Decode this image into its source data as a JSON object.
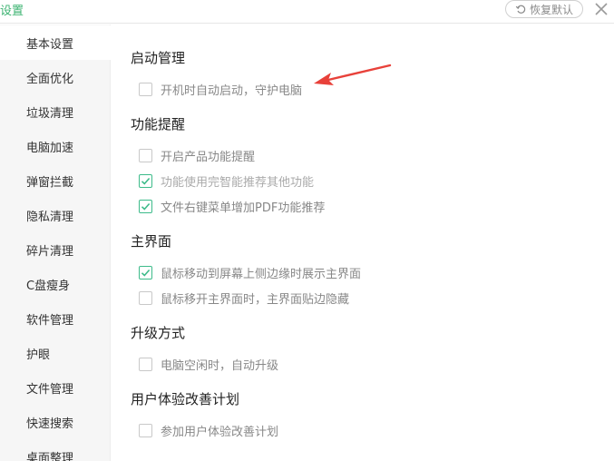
{
  "window": {
    "title": "设置",
    "restore_label": "恢复默认",
    "close_icon": "close-icon"
  },
  "colors": {
    "accent": "#3cb371",
    "check": "#3dbb8a",
    "annotation_arrow": "#e8413a"
  },
  "sidebar": {
    "items": [
      {
        "label": "基本设置",
        "active": true
      },
      {
        "label": "全面优化"
      },
      {
        "label": "垃圾清理"
      },
      {
        "label": "电脑加速"
      },
      {
        "label": "弹窗拦截"
      },
      {
        "label": "隐私清理"
      },
      {
        "label": "碎片清理"
      },
      {
        "label": "C盘瘦身"
      },
      {
        "label": "软件管理"
      },
      {
        "label": "护眼"
      },
      {
        "label": "文件管理"
      },
      {
        "label": "快速搜索"
      },
      {
        "label": "桌面整理"
      }
    ]
  },
  "sections": [
    {
      "title": "启动管理",
      "options": [
        {
          "label": "开机时自动启动，守护电脑",
          "checked": false
        }
      ]
    },
    {
      "title": "功能提醒",
      "options": [
        {
          "label": "开启产品功能提醒",
          "checked": false
        },
        {
          "label": "功能使用完智能推荐其他功能",
          "checked": true,
          "dim": true
        },
        {
          "label": "文件右键菜单增加PDF功能推荐",
          "checked": true
        }
      ]
    },
    {
      "title": "主界面",
      "options": [
        {
          "label": "鼠标移动到屏幕上侧边缘时展示主界面",
          "checked": true
        },
        {
          "label": "鼠标移开主界面时，主界面贴边隐藏",
          "checked": false
        }
      ]
    },
    {
      "title": "升级方式",
      "options": [
        {
          "label": "电脑空闲时，自动升级",
          "checked": false
        }
      ]
    },
    {
      "title": "用户体验改善计划",
      "options": [
        {
          "label": "参加用户体验改善计划",
          "checked": false
        }
      ]
    }
  ]
}
